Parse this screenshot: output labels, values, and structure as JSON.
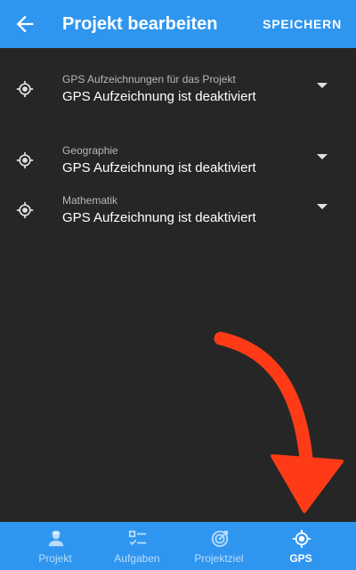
{
  "appbar": {
    "title": "Projekt bearbeiten",
    "action": "SPEICHERN",
    "back_icon": "arrow-back-icon"
  },
  "settings": [
    {
      "label": "GPS Aufzeichnungen für das Projekt",
      "value": "GPS Aufzeichnung ist deaktiviert",
      "icon": "gps-location-icon"
    },
    {
      "label": "Geographie",
      "value": "GPS Aufzeichnung ist deaktiviert",
      "icon": "gps-location-icon"
    },
    {
      "label": "Mathematik",
      "value": "GPS Aufzeichnung ist deaktiviert",
      "icon": "gps-location-icon"
    }
  ],
  "bottom_nav": [
    {
      "label": "Projekt",
      "icon": "person-icon",
      "active": false
    },
    {
      "label": "Aufgaben",
      "icon": "checklist-icon",
      "active": false
    },
    {
      "label": "Projektziel",
      "icon": "target-icon",
      "active": false
    },
    {
      "label": "GPS",
      "icon": "gps-location-icon",
      "active": true
    }
  ],
  "colors": {
    "appbar": "#2f96f0",
    "background": "#262626",
    "annotation_arrow": "#ff3b17"
  }
}
